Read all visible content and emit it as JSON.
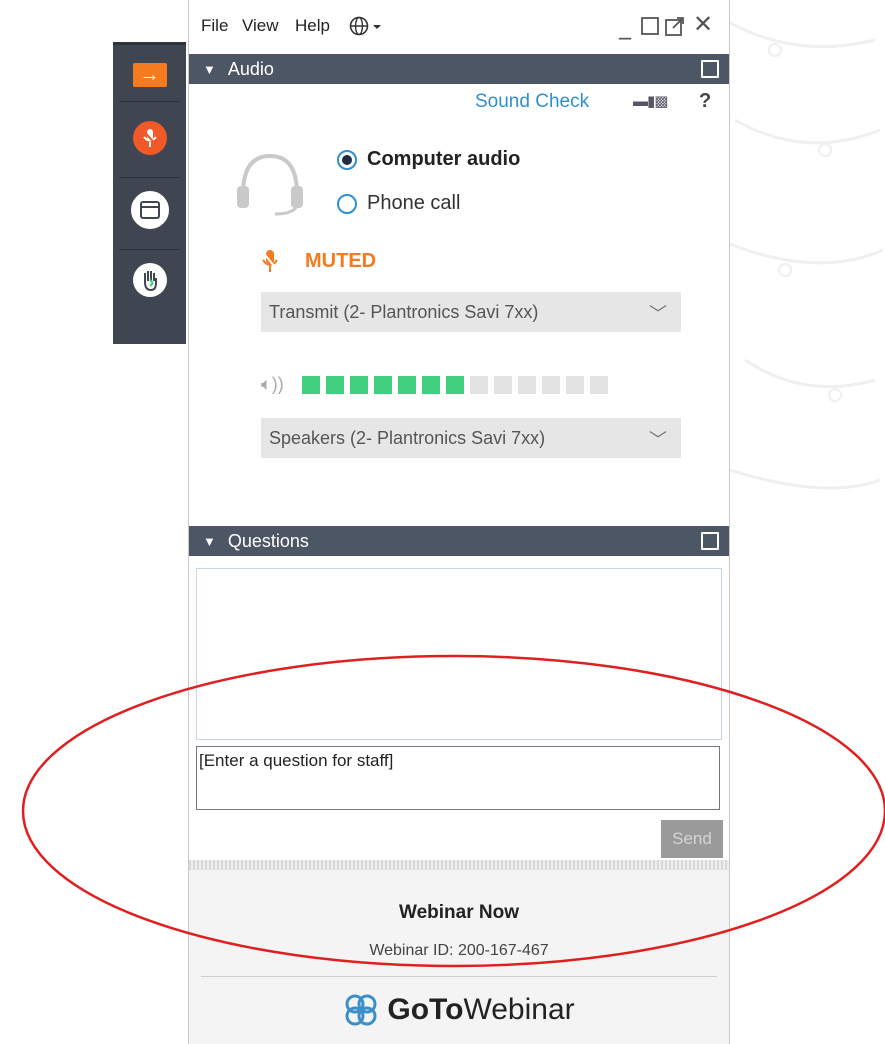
{
  "menu": {
    "file": "File",
    "view": "View",
    "help": "Help"
  },
  "audio_panel": {
    "title": "Audio",
    "sound_check": "Sound Check",
    "help": "?",
    "options": [
      {
        "label": "Computer audio",
        "selected": true
      },
      {
        "label": "Phone call",
        "selected": false
      }
    ],
    "mute_status": "MUTED",
    "microphone": "Transmit (2- Plantronics Savi 7xx)",
    "speaker_level": {
      "active_bars": 7,
      "total_bars": 13
    },
    "speakers": "Speakers (2- Plantronics Savi 7xx)"
  },
  "questions_panel": {
    "title": "Questions",
    "input_value": "[Enter a question for staff]",
    "send_label": "Send"
  },
  "footer": {
    "webinar_title": "Webinar Now",
    "webinar_id": "Webinar ID: 200-167-467",
    "logo_bold": "GoTo",
    "logo_regular": "Webinar"
  },
  "colors": {
    "accent_orange": "#f47b20",
    "link_blue": "#2f8fd0",
    "level_green": "#3fcf7f",
    "header_bg": "#4d5664",
    "sidebar_bg": "#3f4651",
    "annotation_red": "#e02020"
  }
}
